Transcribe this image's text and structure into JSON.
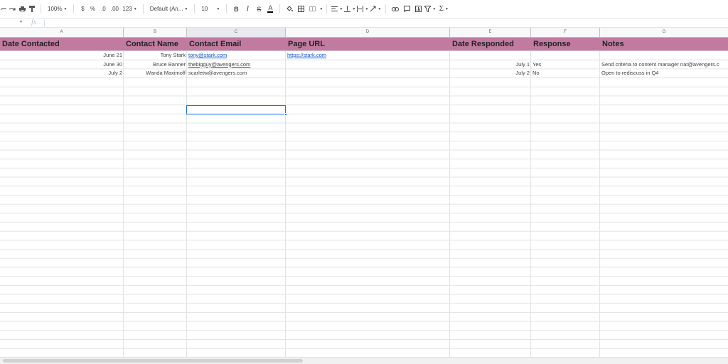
{
  "toolbar": {
    "zoom": "100%",
    "currency": "$",
    "percent": "%",
    "decrease_decimals": ".0",
    "increase_decimals": ".00",
    "more_formats": "123",
    "font": "Default (An...",
    "font_size": "10",
    "bold": "B",
    "italic": "I",
    "strikethrough": "S",
    "text_color": "A",
    "sum": "Σ"
  },
  "formula_bar": {
    "fx": "fx",
    "value": ""
  },
  "columns": [
    "A",
    "B",
    "C",
    "D",
    "E",
    "F",
    "G"
  ],
  "headers": [
    "Date Contacted",
    "Contact Name",
    "Contact Email",
    "Page URL",
    "Date Responded",
    "Response",
    "Notes"
  ],
  "rows": [
    {
      "date": "June 21",
      "name": "Tony Stark",
      "email": "tony@stark.com",
      "url": "https://stark.com",
      "responded": "",
      "response": "",
      "notes": ""
    },
    {
      "date": "June 30",
      "name": "Bruce Banner",
      "email": "thebigguy@avengers.com",
      "url": "",
      "responded": "July 1",
      "response": "Yes",
      "notes": "Send criteria to content manager nat@avengers.c"
    },
    {
      "date": "July 2",
      "name": "Wanda Maximoff",
      "email": "scarletw@avengers.com",
      "url": "",
      "responded": "July 2",
      "response": "No",
      "notes": "Open to rediscuss in Q4"
    }
  ],
  "colors": {
    "header_fill": "#c27ba0",
    "selection": "#1a73e8",
    "link": "#1155cc"
  }
}
